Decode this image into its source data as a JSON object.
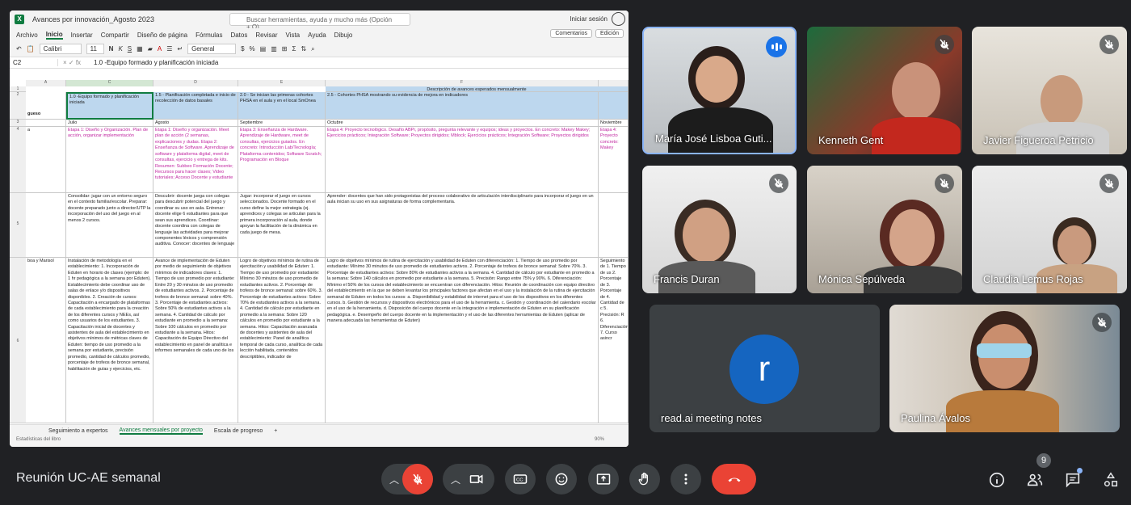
{
  "excel": {
    "title": "Avances por innovación_Agosto 2023",
    "search_placeholder": "Buscar herramientas, ayuda y mucho más (Opción + Q)",
    "signin": "Iniciar sesión",
    "menu": [
      "Archivo",
      "Inicio",
      "Insertar",
      "Compartir",
      "Diseño de página",
      "Fórmulas",
      "Datos",
      "Revisar",
      "Vista",
      "Ayuda",
      "Dibujo"
    ],
    "comments_label": "Comentarios",
    "edit_label": "Edición",
    "font_name": "Calibri",
    "font_size": "11",
    "number_format": "General",
    "cell_ref": "C2",
    "formula": "1.0 -Equipo formado y planificación iniciada",
    "col_headers": [
      "A",
      "C",
      "D",
      "E",
      "F"
    ],
    "row_headers": [
      "1",
      "2",
      "3",
      "4",
      "5",
      "6"
    ],
    "header_banner": "Descripción de avances esperados mensualmente",
    "row2": {
      "a": "gueso",
      "c": "1.0 -Equipo formado y planificación iniciada",
      "d": "1.5 - Planificación completada e inicio de recolección de datos basales",
      "e": "2.0 - Se inician las primeras cohortes PHSA en el aula y en el local SmOnea",
      "f": "2.5 - Cohortes PHSA mostrando su evidencia de mejora en indicadores"
    },
    "months": [
      "Julio",
      "Agosto",
      "Septiembre",
      "Octubre",
      "Noviembre"
    ],
    "row4": {
      "a": "a",
      "c": "Etapa 1: Diseño y Organización. Plan de acción, organizar implementación",
      "d": "Etapa 1: Diseño y organización. Meet plan de acción (2 semanas, explicaciones y dudas. Etapa 2: Enseñanza de Software. Aprendizaje de software y plataforma digital, meet de consultas, ejercicio y entrega de kits. Resumen: Subbeo Formación Docente; Recursos para hacer clases; Video tutoriales; Acceso Docente y estudiante",
      "e": "Etapa 3: Enseñanza de Hardware. Aprendizaje de Hardware, meet de consultas, ejercicios guiados. En concreto: Introducción Lab/Tecnología; Plataforma contenidos; Software Scratch; Programación en Bloque",
      "f": "Etapa 4: Proyecto tecnológico. Desafío ABPr, propósito, pregunta relevante y equipos; ideas y proyectos. En concreto: Makey Makey; Ejercicios prácticos; Integración Software; Proyectos dirigidos; Mblock; Ejercicios prácticos; Integración Software; Proyectos dirigidos",
      "g": "Etapa 4: Proyecto concreto: Makey"
    },
    "row5": {
      "c": "Consolidar: jugar con un entorno seguro en el contexto familiar/escolar. Preparar: docente preparado junto a director/UTP la incorporación del uso del juego en al menos 2 cursos.",
      "d": "Descubrir: docente juega con colegas para descubrir potencial del juego y coordinar su uso en aula. Entrenar: docente elige 6 estudiantes para que sean sus aprendices. Coordinar: docente coordina con colegas de lenguaje las actividades para mejorar componentes léxicos y comprensión auditiva. Conocer: docentes de lenguaje",
      "e": "Jugar: incorporar el juego en cursos seleccionados. Docente formado en el curso define la mejor estrategia (ej. aprendices y colegas se articulan para la primera incorporación al aula, donde apoyan la facilitación de la dinámica en cada juego de mesa.",
      "f": "Aprender: docentes que han sido protagonistas del proceso colaborativo de articulación interdisciplinario para incorporar el juego en un aula inician su uso en sus asignaturas de forma complementaria."
    },
    "row6": {
      "a": "boa y Marisol",
      "c": "Instalación de metodología en el establecimiento: 1. Incorporación de Eduten en horario de clases (ejemplo: de 1 hr pedagógica a la semana por Eduten). Establecimiento debe coordinar uso de salas de enlace y/o dispositivos disponibles. 2. Creación de cursos: Capacitación a encargado de plataformas de cada establecimiento para la creación de los diferentes cursos y NEEs, así como usuarios de los estudiantes. 3. Capacitación inicial de docentes y asistentes de aula del establecimiento en objetivos mínimos de métricas claves de Eduten: tiempo de uso promedio a la semana por estudiante, precisión promedio, cantidad de cálculos promedio, porcentaje de trofeos de bronce semanal, habilitación de guías y ejercicios, etc.",
      "d": "Avance de implementación de Eduten por medio de seguimiento de objetivos mínimos de indicadores claves: 1. Tiempo de uso promedio por estudiante: Entre 20 y 30 minutos de uso promedio de estudiantes activos. 2. Porcentaje de trofeos de bronce semanal: sobre 40%. 3. Porcentaje de estudiantes activos: Sobre 50% de estudiantes activos a la semana. 4. Cantidad de cálculo por estudiante en promedio a la semana: Sobre 100 cálculos en promedio por estudiante a la semana. Hitos: Capacitación de Equipo Directivo del establecimiento en panel de analítica e informes semanales de cada uno de los",
      "e": "Logro de objetivos mínimos de rutina de ejercitación y usabilidad de Eduten: 1. Tiempo de uso promedio por estudiante: Mínimo 30 minutos de uso promedio de estudiantes activos. 2. Porcentaje de trofeos de bronce semanal: sobre 60%. 3. Porcentaje de estudiantes activos: Sobre 70% de estudiantes activos a la semana. 4. Cantidad de cálculo por estudiante en promedio a la semana: Sobre 120 cálculos en promedio por estudiante a la semana. Hitos: Capacitación avanzada de docentes y asistentes de aula del establecimiento: Panel de analítica temporal de cada curso, analítica de cada lección habilitada, contenidos descriptibles, indicador de",
      "f": "Logro de objetivos mínimos de rutina de ejercitación y usabilidad de Eduten con diferenciación: 1. Tiempo de uso promedio por estudiante: Mínimo 30 minutos de uso promedio de estudiantes activos. 2. Porcentaje de trofeos de bronce semanal: Sobre 70%. 3. Porcentaje de estudiantes activos: Sobre 80% de estudiantes activos a la semana. 4. Cantidad de cálculo por estudiante en promedio a la semana: Sobre 140 cálculos en promedio por estudiante a la semana. 5. Precisión: Rango entre 75% y 90%. 6. Diferenciación: Mínimo el 50% de los cursos del establecimiento se encuentran con diferenciación. Hitos: Reunión de coordinación con equipo directivo del establecimiento en la que se deben levantar los principales factores que afectan en el uso y la instalación de la rutina de ejercitación semanal de Eduten en todos los cursos: a. Disponibilidad y estabilidad de internet para el uso de los dispositivos en los diferentes cursos. b. Gestión de recursos y dispositivos electrónicos para el uso de la herramienta. c. Gestión y coordinación del calendario escolar en el uso de la herramienta. d. Disposición del cuerpo docente en la integración e implementación de Eduten en su planificación pedagógica. e. Desempeño del cuerpo docente en la implementación y el uso de las diferentes herramientas de Eduten (aplicar de manera adecuada las herramientas de Eduten)",
      "g": "Seguimiento de 1. Tiempo de us 2. Porcentaje de 3. Porcentaje de 4. Cantidad de c 5. Precisión: R 6. Diferenciación 7. Curso asincr"
    },
    "sheet_tabs": [
      "Seguimiento a expertos",
      "Avances mensuales por proyecto",
      "Escala de progreso"
    ],
    "active_tab_index": 1,
    "status_left": "Estadísticas del libro",
    "zoom": "90%"
  },
  "participants": [
    {
      "name": "María José Lisboa Guti...",
      "state": "speaking"
    },
    {
      "name": "Kenneth Gent",
      "state": "muted"
    },
    {
      "name": "Javier Figueroa Petricio",
      "state": "muted"
    },
    {
      "name": "Francis Duran",
      "state": "muted"
    },
    {
      "name": "Mónica Sepúlveda",
      "state": "muted"
    },
    {
      "name": "Claudia Lemus Rojas",
      "state": "muted"
    },
    {
      "name": "read.ai meeting notes",
      "initial": "r",
      "avatar_color": "#1565c0"
    },
    {
      "name": "Paulina Ávalos",
      "state": "muted"
    }
  ],
  "meeting": {
    "title": "Reunión UC-AE semanal",
    "participant_count": "9"
  },
  "colors": {
    "background": "#202124",
    "control": "#3c4043",
    "red": "#ea4335",
    "accent": "#1a73e8"
  }
}
